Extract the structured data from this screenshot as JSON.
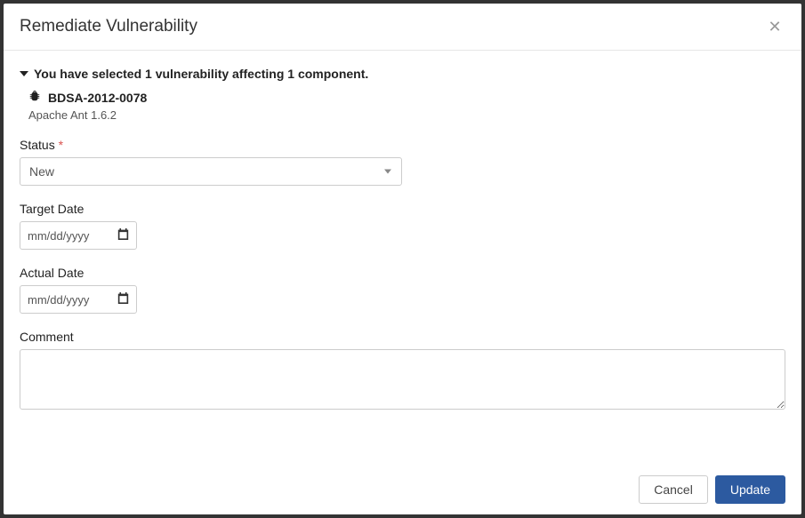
{
  "header": {
    "title": "Remediate Vulnerability"
  },
  "selection": {
    "summary": "You have selected 1 vulnerability affecting 1 component.",
    "vulnerability_id": "BDSA-2012-0078",
    "component": "Apache Ant 1.6.2"
  },
  "form": {
    "status": {
      "label": "Status",
      "required_marker": "*",
      "value": "New"
    },
    "target_date": {
      "label": "Target Date",
      "placeholder": "mm/dd/yyyy"
    },
    "actual_date": {
      "label": "Actual Date",
      "placeholder": "mm/dd/yyyy"
    },
    "comment": {
      "label": "Comment",
      "value": ""
    }
  },
  "footer": {
    "cancel_label": "Cancel",
    "update_label": "Update"
  }
}
